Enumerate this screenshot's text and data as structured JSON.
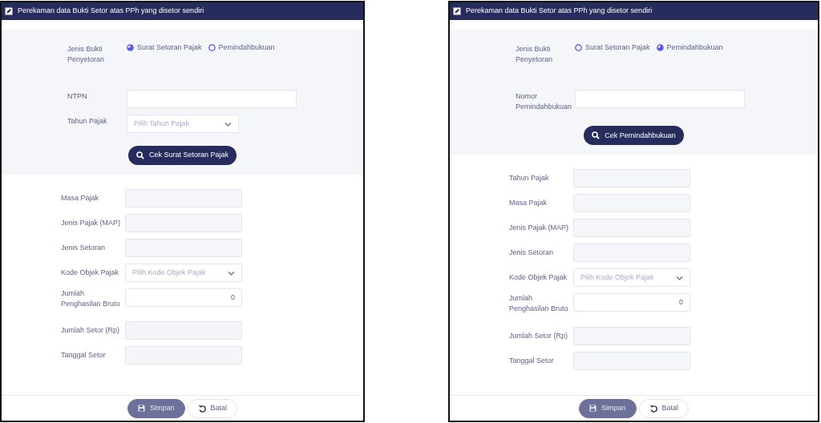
{
  "panels": [
    {
      "title": "Perekaman data Bukti Setor atas PPh yang disetor sendiri",
      "radio_label": "Jenis Bukti Penyetoran",
      "radios": [
        {
          "label": "Surat Setoran Pajak",
          "selected": true
        },
        {
          "label": "Pemindahbukuan",
          "selected": false
        }
      ],
      "top_fields": [
        {
          "label": "NTPN",
          "kind": "text"
        },
        {
          "label": "Tahun Pajak",
          "kind": "select",
          "placeholder": "Pilih Tahun Pajak"
        }
      ],
      "check_button": "Cek Surat Setoran Pajak",
      "fields": [
        {
          "label": "Masa Pajak",
          "kind": "readonly"
        },
        {
          "label": "Jenis Pajak (MAP)",
          "kind": "readonly"
        },
        {
          "label": "Jenis Setoran",
          "kind": "readonly"
        },
        {
          "label": "Kode Objek Pajak",
          "kind": "select",
          "placeholder": "Pilih Kode Objek Pajak"
        },
        {
          "label": "Jumlah Penghasilan Bruto",
          "kind": "number",
          "value": "0"
        },
        {
          "label": "Jumlah Setor (Rp)",
          "kind": "readonly"
        },
        {
          "label": "Tanggal Setor",
          "kind": "readonly"
        }
      ],
      "buttons": [
        {
          "label": "Simpan",
          "kind": "save",
          "disabled": true
        },
        {
          "label": "Batal",
          "kind": "cancel",
          "disabled": false
        }
      ]
    },
    {
      "title": "Perekaman data Bukti Setor atas PPh yang disetor sendiri",
      "radio_label": "Jenis Bukti Penyetoran",
      "radios": [
        {
          "label": "Surat Setoran Pajak",
          "selected": false
        },
        {
          "label": "Pemindahbukuan",
          "selected": true
        }
      ],
      "top_fields": [
        {
          "label": "Nomor Pemindahbukuan",
          "kind": "text"
        }
      ],
      "check_button": "Cek Pemindahbukuan",
      "fields": [
        {
          "label": "Tahun Pajak",
          "kind": "readonly"
        },
        {
          "label": "Masa Pajak",
          "kind": "readonly"
        },
        {
          "label": "Jenis Pajak (MAP)",
          "kind": "readonly"
        },
        {
          "label": "Jenis Setoran",
          "kind": "readonly"
        },
        {
          "label": "Kode Objek Pajak",
          "kind": "select",
          "placeholder": "Pilih Kode Objek Pajak"
        },
        {
          "label": "Jumlah Penghasilan Bruto",
          "kind": "number",
          "value": "0"
        },
        {
          "label": "Jumlah Setor (Rp)",
          "kind": "readonly"
        },
        {
          "label": "Tanggal Setor",
          "kind": "readonly"
        }
      ],
      "buttons": [
        {
          "label": "Simpan",
          "kind": "save",
          "disabled": true
        },
        {
          "label": "Batal",
          "kind": "cancel",
          "disabled": false
        }
      ]
    }
  ]
}
